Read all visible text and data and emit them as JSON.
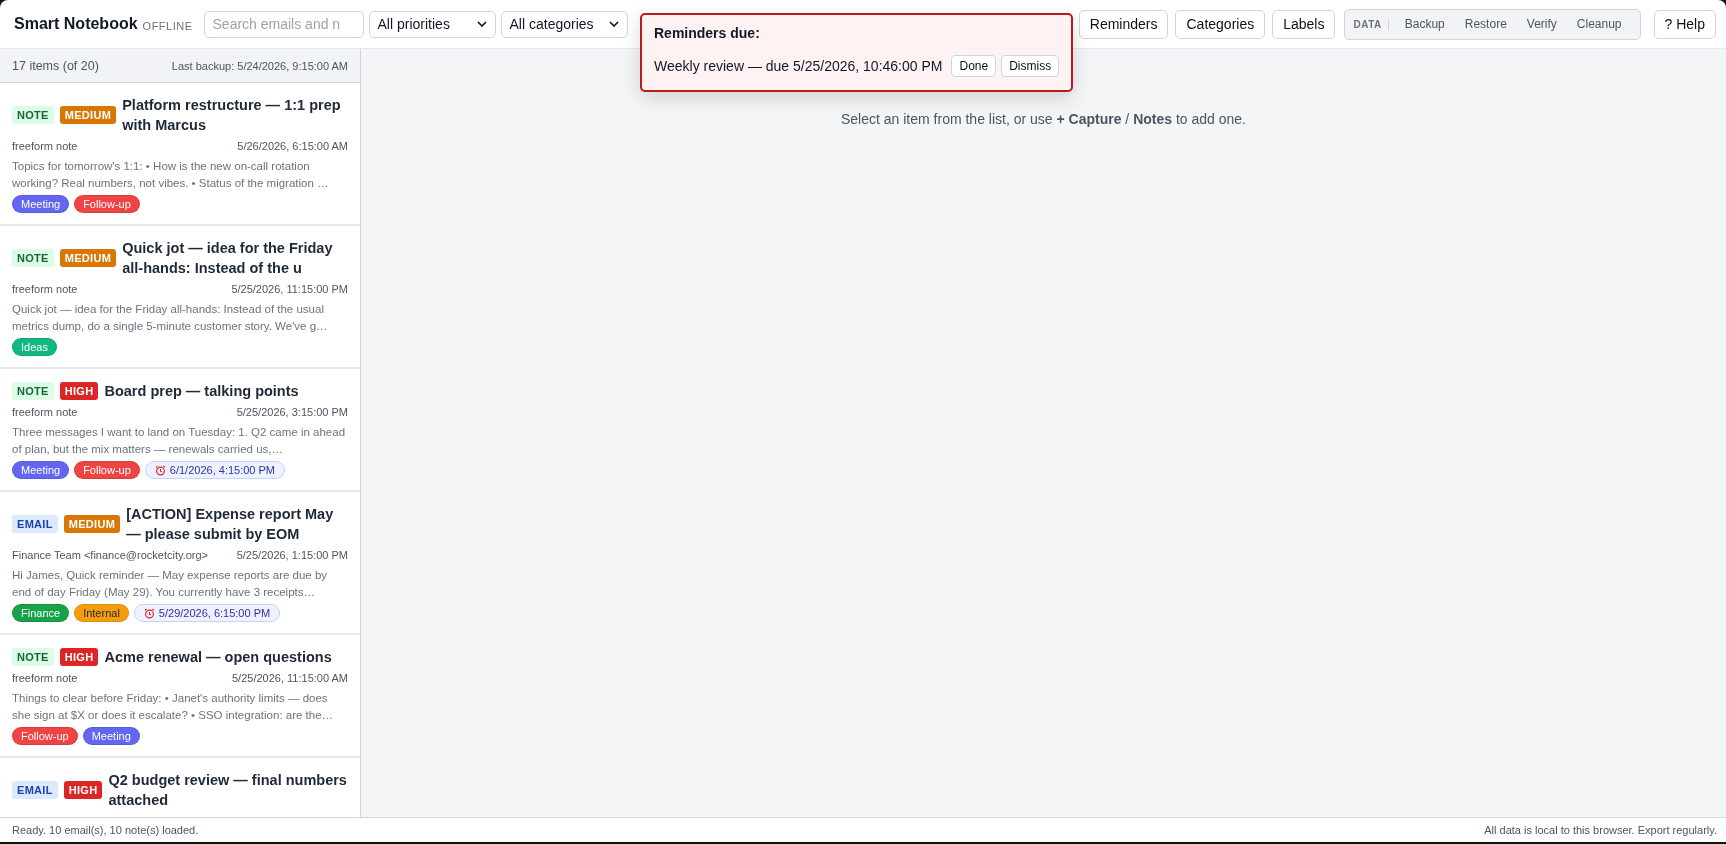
{
  "header": {
    "title": "Smart Notebook",
    "badge": "OFFLINE",
    "search": {
      "placeholder": "Search emails and n"
    },
    "filters": [
      "All priorities",
      "All categories"
    ],
    "buttons": [
      "Reminders",
      "Categories",
      "Labels"
    ],
    "data_group": {
      "label": "DATA",
      "buttons": [
        "Backup",
        "Restore",
        "Verify",
        "Cleanup"
      ]
    },
    "help": "? Help"
  },
  "reminder_popup": {
    "title": "Reminders due:",
    "items": [
      {
        "text": "Weekly review — due 5/25/2026, 10:46:00 PM",
        "actions": [
          "Done",
          "Dismiss"
        ]
      }
    ]
  },
  "list": {
    "count": "17 items (of 20)",
    "last_backup": "Last backup: 5/24/2026, 9:15:00 AM",
    "items": [
      {
        "type": {
          "label": "NOTE",
          "kind": "note"
        },
        "priority": {
          "label": "MEDIUM",
          "kind": "medium"
        },
        "title": "Platform restructure — 1:1 prep with Marcus",
        "from": "freeform note",
        "date": "5/26/2026, 6:15:00 AM",
        "snippet": "Topics for tomorrow's 1:1: • How is the new on-call rotation working? Real numbers, not vibes. • Status of the migration …",
        "tags": [
          {
            "label": "Meeting",
            "color": "#6366f1"
          },
          {
            "label": "Follow-up",
            "color": "#ef4444"
          }
        ]
      },
      {
        "type": {
          "label": "NOTE",
          "kind": "note"
        },
        "priority": {
          "label": "MEDIUM",
          "kind": "medium"
        },
        "title": "Quick jot — idea for the Friday all-hands: Instead of the u",
        "from": "freeform note",
        "date": "5/25/2026, 11:15:00 PM",
        "snippet": "Quick jot — idea for the Friday all-hands: Instead of the usual metrics dump, do a single 5-minute customer story. We've g…",
        "tags": [
          {
            "label": "Ideas",
            "color": "#10b981"
          }
        ]
      },
      {
        "type": {
          "label": "NOTE",
          "kind": "note"
        },
        "priority": {
          "label": "HIGH",
          "kind": "high"
        },
        "title": "Board prep — talking points",
        "from": "freeform note",
        "date": "5/25/2026, 3:15:00 PM",
        "snippet": "Three messages I want to land on Tuesday: 1. Q2 came in ahead of plan, but the mix matters — renewals carried us,…",
        "tags": [
          {
            "label": "Meeting",
            "color": "#6366f1"
          },
          {
            "label": "Follow-up",
            "color": "#ef4444"
          }
        ],
        "reminder": "6/1/2026, 4:15:00 PM"
      },
      {
        "type": {
          "label": "EMAIL",
          "kind": "email"
        },
        "priority": {
          "label": "MEDIUM",
          "kind": "medium"
        },
        "title": "[ACTION] Expense report May — please submit by EOM",
        "from": "Finance Team <finance@rocketcity.org>",
        "date": "5/25/2026, 1:15:00 PM",
        "snippet": "Hi James, Quick reminder — May expense reports are due by end of day Friday (May 29). You currently have 3 receipts…",
        "tags": [
          {
            "label": "Finance",
            "color": "#16a34a"
          },
          {
            "label": "Internal",
            "color": "#f59e0b"
          }
        ],
        "reminder": "5/29/2026, 6:15:00 PM"
      },
      {
        "type": {
          "label": "NOTE",
          "kind": "note"
        },
        "priority": {
          "label": "HIGH",
          "kind": "high"
        },
        "title": "Acme renewal — open questions",
        "from": "freeform note",
        "date": "5/25/2026, 11:15:00 AM",
        "snippet": "Things to clear before Friday: • Janet's authority limits — does she sign at $X or does it escalate? • SSO integration: are the…",
        "tags": [
          {
            "label": "Follow-up",
            "color": "#ef4444"
          },
          {
            "label": "Meeting",
            "color": "#6366f1"
          }
        ]
      },
      {
        "type": {
          "label": "EMAIL",
          "kind": "email"
        },
        "priority": {
          "label": "HIGH",
          "kind": "high"
        },
        "title": "Q2 budget review — final numbers attached"
      }
    ]
  },
  "main": {
    "empty_text": "Select an item from the list, or use **+ Capture** / **Notes** to add one."
  },
  "status_bar": {
    "left": "Ready. 10 email(s), 10 note(s) loaded.",
    "right": "All data is local to this browser. Export regularly."
  }
}
